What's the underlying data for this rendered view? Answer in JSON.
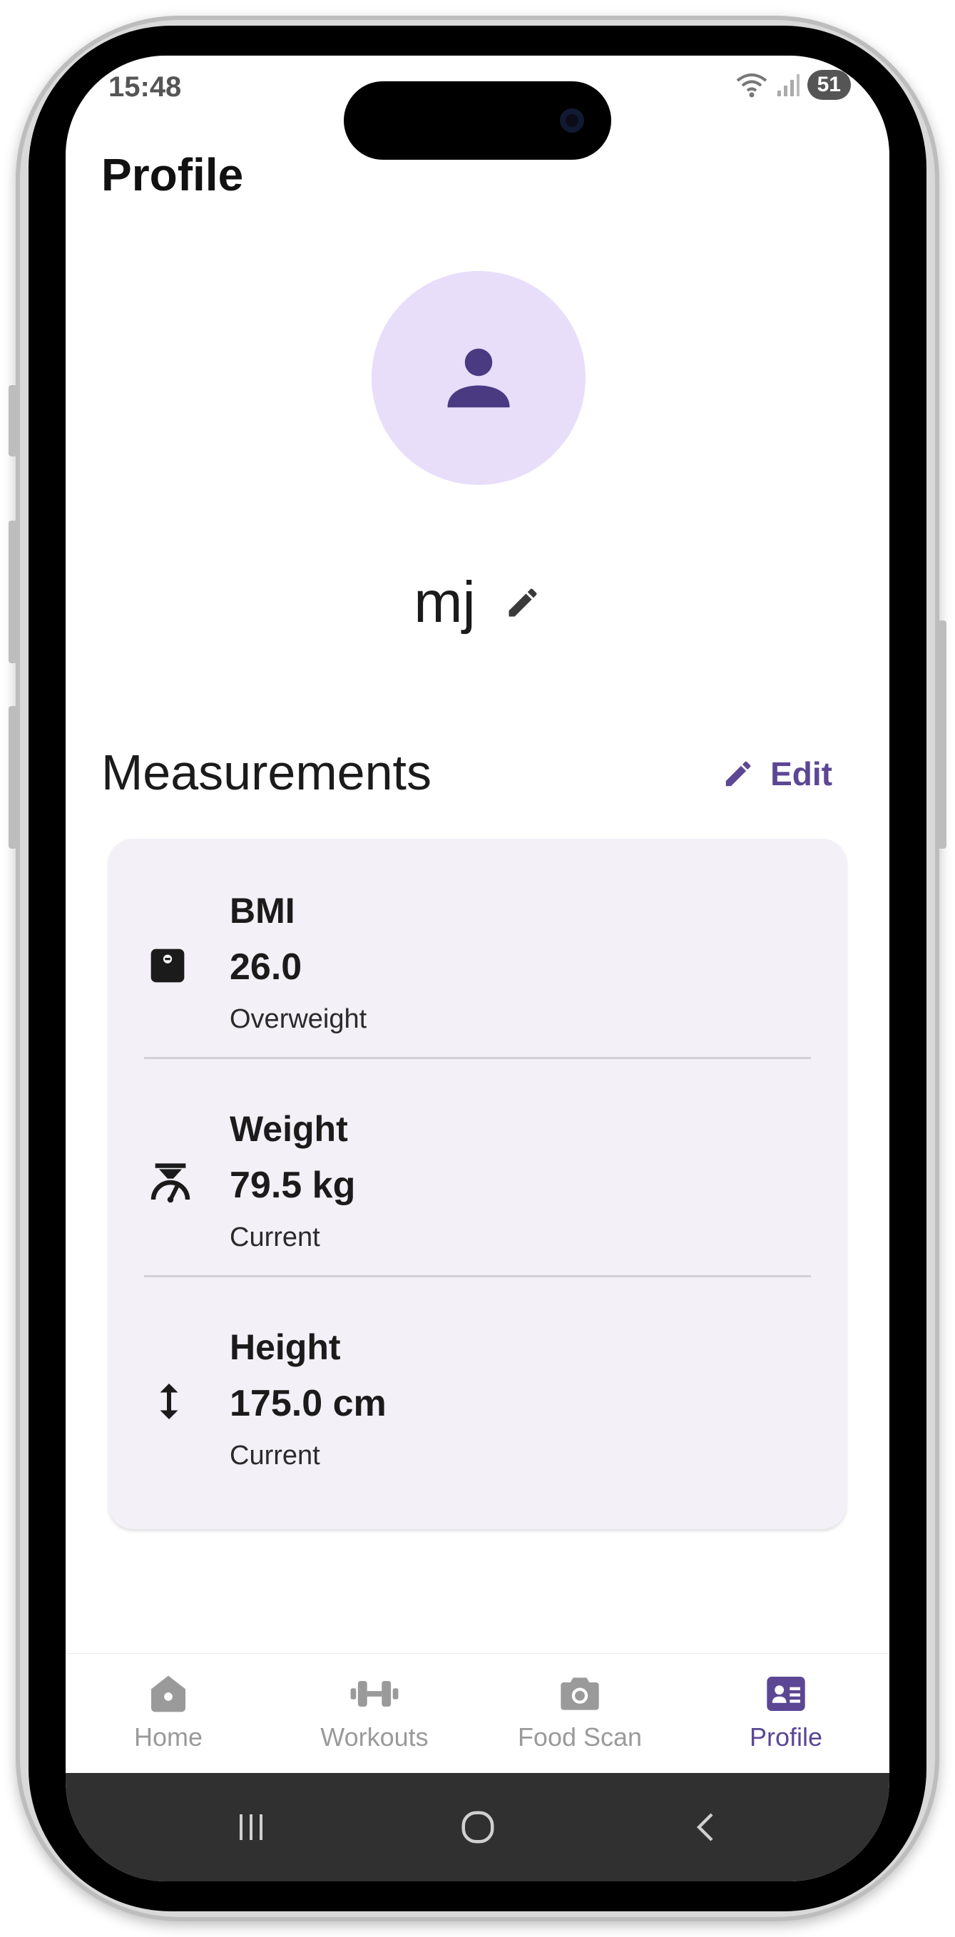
{
  "status_bar": {
    "time": "15:48",
    "battery": "51"
  },
  "header": {
    "title": "Profile"
  },
  "profile": {
    "name": "mj"
  },
  "measurements": {
    "title": "Measurements",
    "edit_label": "Edit",
    "items": [
      {
        "label": "BMI",
        "value": "26.0",
        "sub": "Overweight",
        "icon": "scale-icon"
      },
      {
        "label": "Weight",
        "value": "79.5 kg",
        "sub": "Current",
        "icon": "weight-scale-icon"
      },
      {
        "label": "Height",
        "value": "175.0 cm",
        "sub": "Current",
        "icon": "vertical-arrows-icon"
      }
    ]
  },
  "bottom_nav": {
    "items": [
      {
        "label": "Home",
        "icon": "home-icon"
      },
      {
        "label": "Workouts",
        "icon": "dumbbell-icon"
      },
      {
        "label": "Food Scan",
        "icon": "camera-icon"
      },
      {
        "label": "Profile",
        "icon": "profile-card-icon"
      }
    ],
    "active_color": "#5b4794",
    "inactive_color": "#9a9a9a"
  },
  "colors": {
    "accent": "#5b4794",
    "avatar_bg": "#e8defa",
    "card_bg": "#f3f0f7"
  }
}
